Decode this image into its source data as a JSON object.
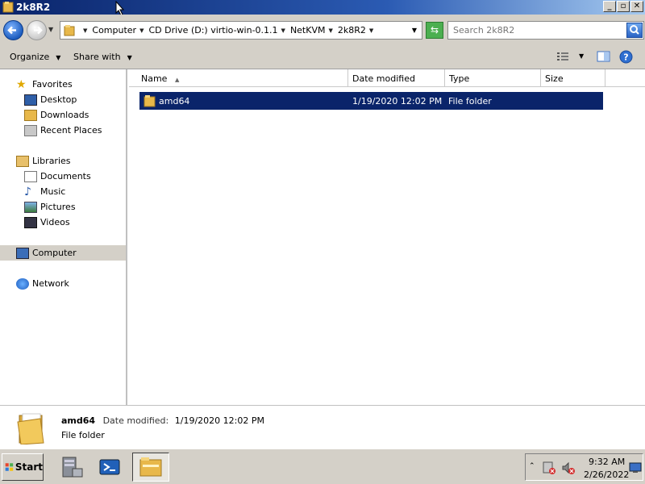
{
  "window": {
    "title": "2k8R2"
  },
  "address": {
    "crumbs": [
      "Computer",
      "CD Drive (D:) virtio-win-0.1.1",
      "NetKVM",
      "2k8R2"
    ]
  },
  "search": {
    "placeholder": "Search 2k8R2"
  },
  "toolbar": {
    "organize_label": "Organize",
    "share_label": "Share with"
  },
  "nav": {
    "favorites": "Favorites",
    "desktop": "Desktop",
    "downloads": "Downloads",
    "recent": "Recent Places",
    "libraries": "Libraries",
    "documents": "Documents",
    "music": "Music",
    "pictures": "Pictures",
    "videos": "Videos",
    "computer": "Computer",
    "network": "Network"
  },
  "columns": {
    "name": "Name",
    "date": "Date modified",
    "type": "Type",
    "size": "Size"
  },
  "files": [
    {
      "name": "amd64",
      "date": "1/19/2020 12:02 PM",
      "type": "File folder",
      "size": ""
    }
  ],
  "details": {
    "name": "amd64",
    "date_label": "Date modified:",
    "date_value": "1/19/2020 12:02 PM",
    "type": "File folder"
  },
  "taskbar": {
    "start_label": "Start",
    "time": "9:32 AM",
    "date": "2/26/2022"
  },
  "colors": {
    "selection": "#0a246a",
    "titlebar": "#0a246a",
    "chrome": "#d4d0c8"
  }
}
